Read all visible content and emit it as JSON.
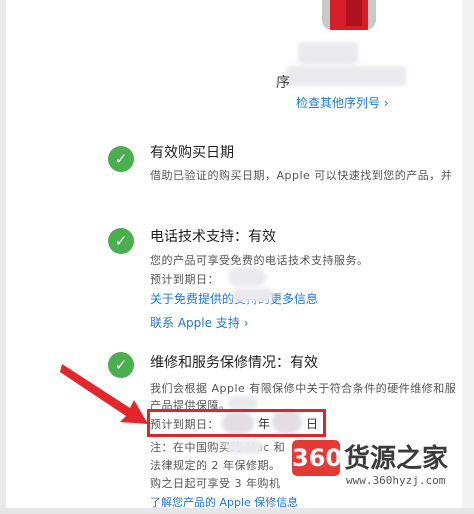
{
  "header": {
    "serial_prefix": "序",
    "view_other_serial_link": "检查其他序列号 ›"
  },
  "sections": [
    {
      "title": "有效购买日期",
      "description": "借助已验证的购买日期，Apple 可以快速找到您的产品，并"
    },
    {
      "title": "电话技术支持：有效",
      "description": "您的产品可享受免费的电话技术支持服务。",
      "expiry_label": "预计到期日：",
      "link_more": "关于免费提供的支持的更多信息",
      "link_contact": "联系 Apple 支持 ›"
    },
    {
      "title": "维修和服务保修情况：有效",
      "description_line1": "我们会根据 Apple 有限保修中关于符合条件的硬件维修和服",
      "description_line2": "产品提供保障。",
      "expiry_label": "预计到期日：",
      "expiry_year_suffix": "年",
      "expiry_day_suffix": "日",
      "note_line1": "注：在中国购买的 Mac 和",
      "note_line2": "法律规定的 2 年保修期。",
      "note_line3": "购之日起可享受 3 年购机",
      "link_learn": "了解您产品的 Apple 保修信息"
    }
  ],
  "watermark": {
    "badge": "360",
    "text": "货源之家",
    "url": "www.360hyzj.com"
  },
  "colors": {
    "check_green": "#4bae4f",
    "link_blue": "#1f78d1",
    "highlight_red": "#d9272e"
  }
}
